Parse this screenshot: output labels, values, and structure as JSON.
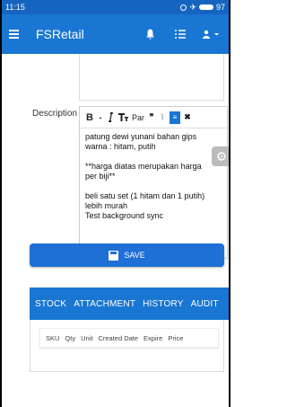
{
  "status_bar": {
    "time": "11:15",
    "battery": "97"
  },
  "app_bar": {
    "title": "FSRetail"
  },
  "form": {
    "description_label": "Description"
  },
  "editor": {
    "toolbar": {
      "bold": "B",
      "dash": "-",
      "heading": "Par",
      "quote": "❞",
      "more": "⁝"
    },
    "lines": [
      "patung dewi yunani bahan gips",
      "warna : hitam, putih",
      "",
      "**harga diatas merupakan harga",
      "per biji**",
      "",
      "beli satu set (1 hitam dan 1 putih)",
      "lebih murah",
      "Test background sync"
    ]
  },
  "save_button": {
    "label": "SAVE"
  },
  "tabs": [
    "STOCK",
    "ATTACHMENT",
    "HISTORY",
    "AUDIT"
  ],
  "stock_table": {
    "columns": [
      "SKU",
      "Qty",
      "Unit",
      "Created Date",
      "Expire",
      "Price"
    ]
  }
}
